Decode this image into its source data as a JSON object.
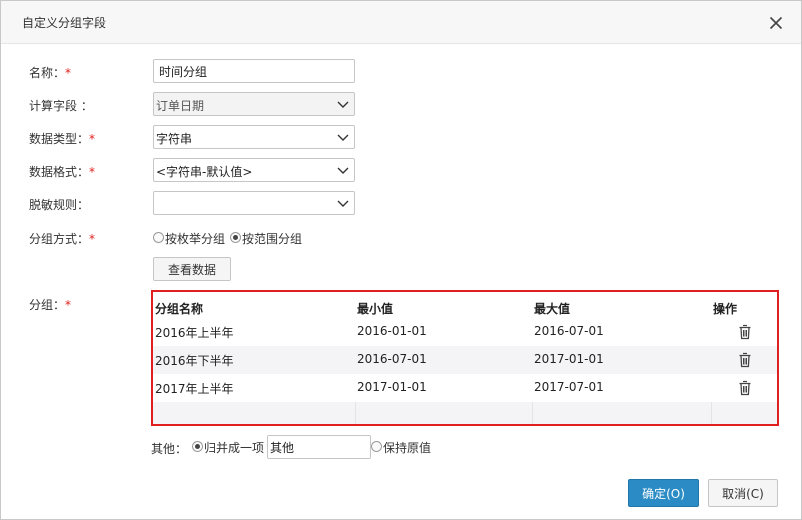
{
  "dialog": {
    "title": "自定义分组字段",
    "close_icon": "close-icon"
  },
  "form": {
    "name": {
      "label": "名称：",
      "required": "*",
      "value": "时间分组"
    },
    "calc_field": {
      "label": "计算字段 ：",
      "value": "订单日期"
    },
    "data_type": {
      "label": "数据类型：",
      "required": "*",
      "value": "字符串"
    },
    "data_format": {
      "label": "数据格式：",
      "required": "*",
      "value": "<字符串-默认值>"
    },
    "desensitize": {
      "label": "脱敏规则：",
      "value": ""
    },
    "group_method": {
      "label": "分组方式：",
      "required": "*",
      "options": [
        {
          "label": "按枚举分组",
          "selected": false
        },
        {
          "label": "按范围分组",
          "selected": true
        }
      ]
    },
    "view_data_button": "查看数据",
    "groups": {
      "label": "分组：",
      "required": "*",
      "columns": [
        "分组名称",
        "最小值",
        "最大值",
        "操作"
      ],
      "rows": [
        {
          "name": "2016年上半年",
          "min": "2016-01-01",
          "max": "2016-07-01",
          "action_icon": "trash-icon"
        },
        {
          "name": "2016年下半年",
          "min": "2016-07-01",
          "max": "2017-01-01",
          "action_icon": "trash-icon"
        },
        {
          "name": "2017年上半年",
          "min": "2017-01-01",
          "max": "2017-07-01",
          "action_icon": "trash-icon"
        }
      ]
    },
    "other": {
      "label": "其他：",
      "merge_option": {
        "label": "归并成一项",
        "selected": true
      },
      "merge_value": "其他",
      "keep_option": {
        "label": "保持原值",
        "selected": false
      }
    }
  },
  "footer": {
    "ok_label": "确定(O)",
    "cancel_label": "取消(C)"
  }
}
